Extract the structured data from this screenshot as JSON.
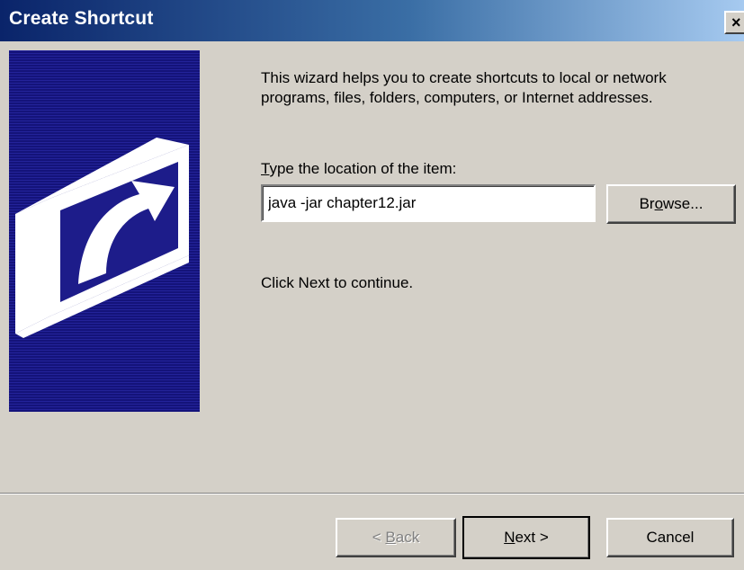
{
  "window": {
    "title": "Create Shortcut",
    "close_symbol": "×",
    "close_icon": "close-icon"
  },
  "banner": {
    "icon": "shortcut-arrow-icon",
    "colors": {
      "background": "#1d1c8a",
      "glyph": "#ffffff"
    }
  },
  "content": {
    "intro": "This wizard helps you to create shortcuts to local or network programs, files, folders, computers, or Internet addresses.",
    "location_label_accel": "T",
    "location_label_rest": "ype the location of the item:",
    "location_value": "java -jar chapter12.jar",
    "browse_pre": "Br",
    "browse_accel": "o",
    "browse_post": "wse...",
    "continue_text": "Click Next to continue."
  },
  "footer": {
    "back_pre": "< ",
    "back_accel": "B",
    "back_post": "ack",
    "back_enabled": false,
    "next_accel": "N",
    "next_post": "ext >",
    "cancel_label": "Cancel"
  },
  "colors": {
    "title_gradient_start": "#0a246a",
    "title_gradient_end": "#a6caf0",
    "face": "#d4d0c8"
  }
}
